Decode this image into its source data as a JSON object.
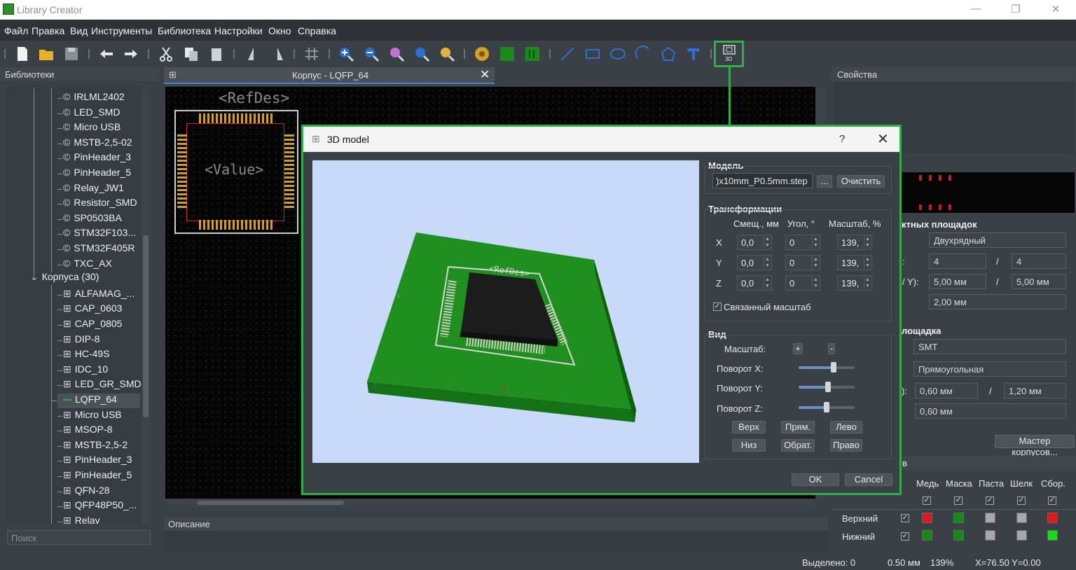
{
  "app": {
    "title": "Library Creator"
  },
  "window_controls": {
    "minimize": "—",
    "maximize": "❐",
    "close": "✕"
  },
  "menu": [
    "Файл",
    "Правка",
    "Вид",
    "Инструменты",
    "Библиотека",
    "Настройки",
    "Окно",
    "Справка"
  ],
  "toolbar": {
    "btn3d_label": "3D"
  },
  "libraries": {
    "header": "Библиотеки",
    "symbols": [
      "IRLML2402",
      "LED_SMD",
      "Micro USB",
      "MSTB-2,5-02",
      "PinHeader_3",
      "PinHeader_5",
      "Relay_JW1",
      "Resistor_SMD",
      "SP0503BA",
      "STM32F103...",
      "STM32F405R",
      "TXC_AX"
    ],
    "folder": "Корпуса (30)",
    "footprints": [
      "ALFAMAG_...",
      "CAP_0603",
      "CAP_0805",
      "DIP-8",
      "HC-49S",
      "IDC_10",
      "LED_GR_SMD",
      "LQFP_64",
      "Micro USB",
      "MSOP-8",
      "MSTB-2,5-2",
      "PinHeader_3",
      "PinHeader_5",
      "QFN-28",
      "QFP48P50_...",
      "Relay"
    ],
    "selected": "LQFP_64",
    "search_placeholder": "Поиск"
  },
  "document_tab": {
    "title": "Корпус - LQFP_64"
  },
  "canvas": {
    "refdes": "<RefDes>",
    "value": "<Value>"
  },
  "description": {
    "header": "Описание"
  },
  "properties": {
    "header": "Свойства",
    "pads_section": "ктных площадок",
    "layout_type": "Двухрядный",
    "count_label": ":",
    "count_a": "4",
    "count_b": "4",
    "pitch_label": "/ Y):",
    "pitch_x": "5,00 мм",
    "pitch_y": "5,00 мм",
    "dist": "2,00 мм",
    "pad_section": "лощадка",
    "pad_type": "SMT",
    "pad_shape": "Прямоугольная",
    "size_label": "):",
    "size_w": "0,60 мм",
    "size_h": "1,20 мм",
    "size_r": "0,60 мм",
    "slash": "/",
    "wizard_button": "Мастер корпусов...",
    "layers_section": "в",
    "layer_cols": [
      "Медь",
      "Маска",
      "Паста",
      "Шелк",
      "Сбор."
    ],
    "layer_rows": [
      {
        "name": "Верхний",
        "swatches": [
          "#e01818",
          "#138a13",
          "#a8a8a8",
          "#a8a8a8",
          "#e01818"
        ]
      },
      {
        "name": "Нижний",
        "swatches": [
          "#138a13",
          "#138a13",
          "#a8a8a8",
          "#a8a8a8",
          "#18d818"
        ]
      }
    ]
  },
  "dialog": {
    "title": "3D model",
    "help": "?",
    "close": "✕",
    "model_section": "Модель",
    "model_file": ")x10mm_P0.5mm.step",
    "browse_button": "...",
    "clear_button": "Очистить",
    "transform_section": "Трансформации",
    "col_offset": "Смещ., мм",
    "col_angle": "Угол, °",
    "col_scale": "Масштаб, %",
    "rows": [
      {
        "axis": "X",
        "offset": "0,0",
        "angle": "0",
        "scale": "139,"
      },
      {
        "axis": "Y",
        "offset": "0,0",
        "angle": "0",
        "scale": "139,"
      },
      {
        "axis": "Z",
        "offset": "0,0",
        "angle": "0",
        "scale": "139,"
      }
    ],
    "linked_scale": "Связанный масштаб",
    "view_section": "Вид",
    "zoom_label": "Масштаб:",
    "zoom_in": "+",
    "zoom_out": "-",
    "rot_x_label": "Поворот X:",
    "rot_y_label": "Поворот Y:",
    "rot_z_label": "Поворот Z:",
    "rot_x": 0.62,
    "rot_y": 0.52,
    "rot_z": 0.5,
    "view_buttons": [
      "Верх",
      "Прям.",
      "Лево",
      "Низ",
      "Обрат.",
      "Право"
    ],
    "ok": "OK",
    "cancel": "Cancel",
    "render": {
      "refdes": "<RefDes>",
      "axis_x": "X",
      "axis_y": "Y",
      "axis_z": "Z"
    }
  },
  "status": {
    "selected": "Выделено: 0",
    "grid": "0.50 мм",
    "zoom": "139%",
    "coords": "X=76.50  Y=0.00"
  },
  "colors": {
    "highlight": "#2fae4a",
    "board": "#1f8f1f",
    "viewport_bg": "#c7daf8"
  }
}
